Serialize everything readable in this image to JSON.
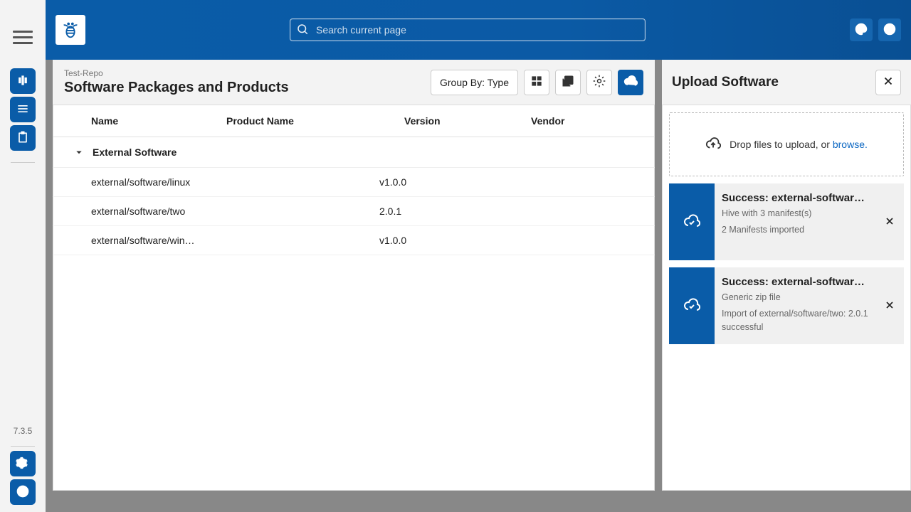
{
  "header": {
    "search_placeholder": "Search current page"
  },
  "rail": {
    "version": "7.3.5"
  },
  "main": {
    "breadcrumb": "Test-Repo",
    "title": "Software Packages and Products",
    "group_by_label": "Group By: Type",
    "columns": {
      "name": "Name",
      "product": "Product Name",
      "version": "Version",
      "vendor": "Vendor"
    },
    "group": {
      "label": "External Software",
      "rows": [
        {
          "name": "external/software/linux",
          "product": "",
          "version": "v1.0.0",
          "vendor": ""
        },
        {
          "name": "external/software/two",
          "product": "",
          "version": "2.0.1",
          "vendor": ""
        },
        {
          "name": "external/software/win…",
          "product": "",
          "version": "v1.0.0",
          "vendor": ""
        }
      ]
    }
  },
  "upload": {
    "title": "Upload Software",
    "drop_prefix": "Drop files to upload, or ",
    "browse": "browse.",
    "items": [
      {
        "title": "Success: external-software-…",
        "line1": "Hive with 3 manifest(s)",
        "line2": "2 Manifests imported"
      },
      {
        "title": "Success: external-software-…",
        "line1": "Generic zip file",
        "line2": "Import of external/software/two: 2.0.1 successful"
      }
    ]
  },
  "colors": {
    "primary": "#0a5ca8",
    "link": "#0a66c2"
  }
}
